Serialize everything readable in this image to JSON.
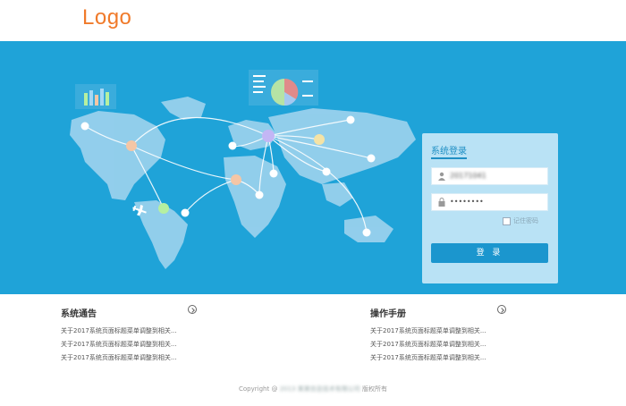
{
  "header": {
    "logo": "Logo"
  },
  "login": {
    "title": "系统登录",
    "username_value": "20171041",
    "password_value": "••••••••",
    "remember_label": "记住密码",
    "submit_label": "登 录"
  },
  "notice": {
    "title": "系统通告",
    "items": [
      "关于2017系统页面标题菜单调整到相关...",
      "关于2017系统页面标题菜单调整到相关...",
      "关于2017系统页面标题菜单调整到相关..."
    ]
  },
  "manual": {
    "title": "操作手册",
    "items": [
      "关于2017系统页面标题菜单调整到相关...",
      "关于2017系统页面标题菜单调整到相关...",
      "关于2017系统页面标题菜单调整到相关..."
    ]
  },
  "footer": {
    "copyright_prefix": "Copyright @",
    "blurred_company": "2013 某某信息技术有限公司",
    "suffix": "版权所有"
  },
  "colors": {
    "brand": "#f07a2a",
    "banner": "#1fa3d8",
    "button": "#1b96ce"
  }
}
